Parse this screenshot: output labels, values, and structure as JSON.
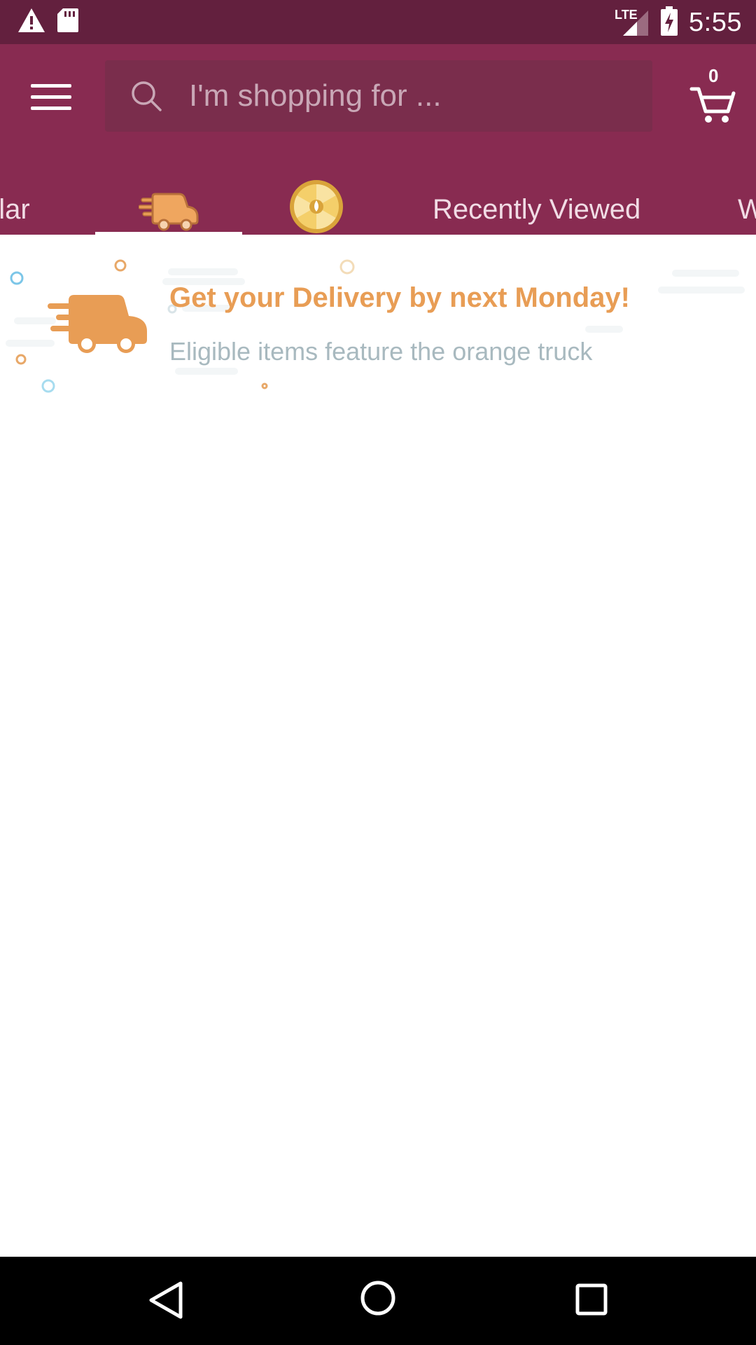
{
  "status_bar": {
    "time": "5:55",
    "network": "LTE",
    "icons": [
      "warning-icon",
      "sd-card-icon",
      "signal-icon",
      "battery-charging-icon"
    ]
  },
  "header": {
    "menu_icon": "hamburger-menu-icon",
    "search": {
      "placeholder": "I'm shopping for ..."
    },
    "cart": {
      "count": "0",
      "icon": "cart-icon"
    }
  },
  "tabs": {
    "items": [
      {
        "label": "ular",
        "type": "text"
      },
      {
        "label": "",
        "type": "icon",
        "icon": "delivery-truck-icon",
        "selected": true
      },
      {
        "label": "",
        "type": "icon",
        "icon": "deal-wheel-icon"
      },
      {
        "label": "Recently Viewed",
        "type": "text"
      },
      {
        "label": "W",
        "type": "text"
      }
    ]
  },
  "banner": {
    "title": "Get your Delivery by next Monday!",
    "subtitle": "Eligible items feature the orange truck",
    "icon": "orange-truck-icon"
  },
  "colors": {
    "status_bar": "#63203e",
    "app_bar": "#882b51",
    "accent_orange": "#e89d55",
    "subtitle_gray": "#a8b9bf"
  },
  "nav_bar": {
    "icons": [
      "back-icon",
      "home-icon",
      "recents-icon"
    ]
  }
}
